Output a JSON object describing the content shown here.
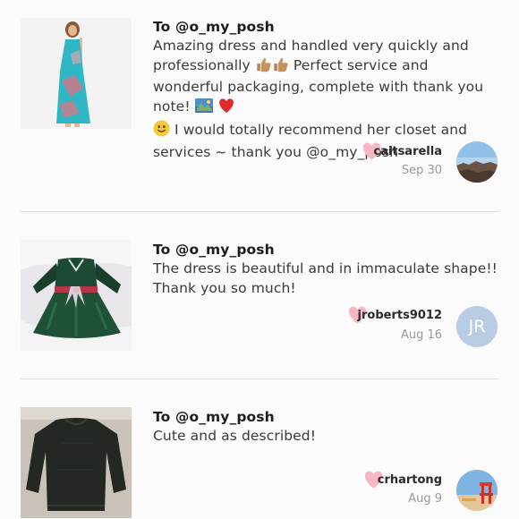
{
  "reviews": [
    {
      "to": "To @o_my_posh",
      "message": {
        "p1": "Amazing dress and handled very quickly and professionally ",
        "p2": " Perfect service and wonderful packaging, complete with thank you note! ",
        "p3": " I would totally recommend her closet and services ~ thank you @o_my_posh"
      },
      "emojis": [
        "thumbs-up-icon",
        "thumbs-up-icon",
        "picture-icon",
        "red-heart-icon",
        "smiling-face-icon"
      ],
      "username": "caitsarella",
      "date": "Sep 30",
      "avatar": "photo",
      "liked": true
    },
    {
      "to": "To @o_my_posh",
      "message": {
        "p1": "The dress is beautiful and in immaculate shape!! Thank you so much!"
      },
      "username": "jroberts9012",
      "date": "Aug 16",
      "avatar_initials": "JR",
      "avatar_color": "#b8cde3",
      "liked": true
    },
    {
      "to": "To @o_my_posh",
      "message": {
        "p1": "Cute and as described!"
      },
      "username": "crhartong",
      "date": "Aug 9",
      "avatar": "photo",
      "liked": true
    }
  ],
  "colors": {
    "heart": "#f5b8c4",
    "divider": "#dddddd",
    "background": "#fcfbfc"
  }
}
